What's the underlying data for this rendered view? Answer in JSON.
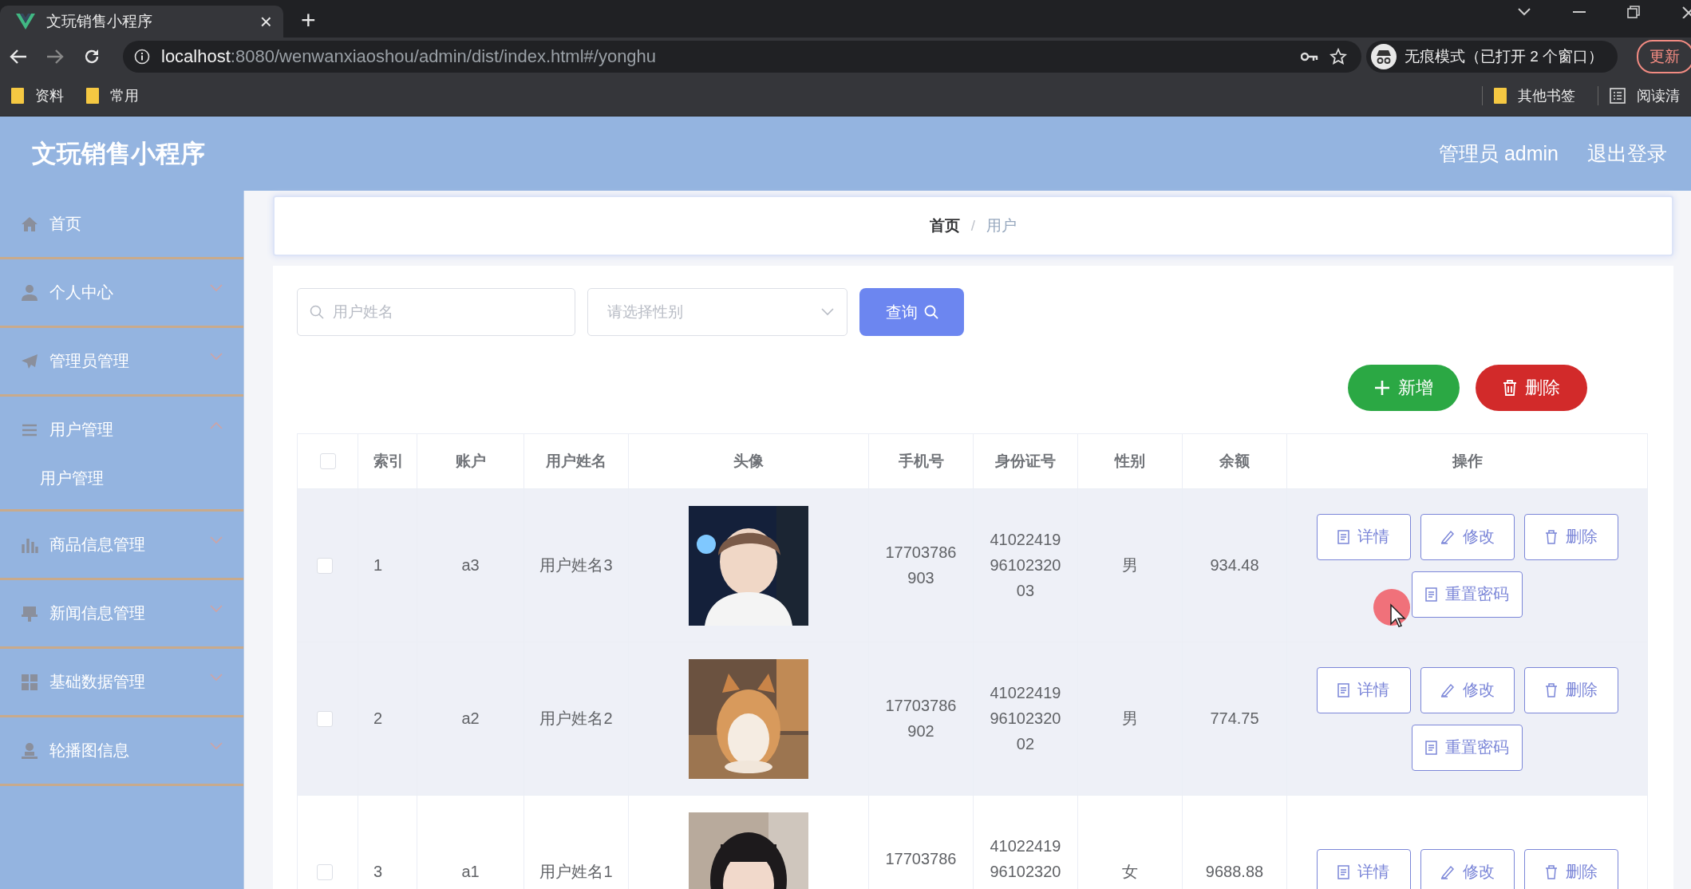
{
  "browser": {
    "tab_title": "文玩销售小程序",
    "tab_close": "×",
    "new_tab": "+",
    "url_host": "localhost",
    "url_path": ":8080/wenwanxiaoshou/admin/dist/index.html#/yonghu",
    "incognito": "无痕模式（已打开 2 个窗口）",
    "update": "更新",
    "bookmarks": [
      {
        "label": "资料",
        "kind": "folder"
      },
      {
        "label": "常用",
        "kind": "folder"
      }
    ],
    "bookmarks_right": [
      {
        "label": "其他书签",
        "kind": "folder"
      },
      {
        "label": "阅读清",
        "kind": "reader"
      }
    ]
  },
  "header": {
    "title": "文玩销售小程序",
    "user": "管理员 admin",
    "logout": "退出登录"
  },
  "sidebar": {
    "items": [
      {
        "label": "首页"
      },
      {
        "label": "个人中心",
        "expanded": false
      },
      {
        "label": "管理员管理",
        "expanded": false
      },
      {
        "label": "用户管理",
        "expanded": true,
        "children": [
          {
            "label": "用户管理"
          }
        ]
      },
      {
        "label": "商品信息管理",
        "expanded": false
      },
      {
        "label": "新闻信息管理",
        "expanded": false
      },
      {
        "label": "基础数据管理",
        "expanded": false
      },
      {
        "label": "轮播图信息",
        "expanded": false
      }
    ]
  },
  "breadcrumb": [
    {
      "label": "首页",
      "current": false
    },
    {
      "label": "用户",
      "current": true
    }
  ],
  "breadcrumb_separator": "/",
  "search": {
    "name_placeholder": "用户姓名",
    "gender_placeholder": "请选择性别",
    "button": "查询"
  },
  "toolbar": {
    "add": "新增",
    "delete": "删除"
  },
  "table": {
    "columns": [
      "索引",
      "账户",
      "用户姓名",
      "头像",
      "手机号",
      "身份证号",
      "性别",
      "余额",
      "操作"
    ],
    "header_checked": false,
    "rows": [
      {
        "checked": false,
        "highlighted": true,
        "index": "1",
        "account": "a3",
        "name": "用户姓名3",
        "avatar": {
          "kind": "picture"
        },
        "phone": "17703786903",
        "id_number": "410224199610232003",
        "gender": "男",
        "balance": "934.48",
        "actions": [
          {
            "label": "详情",
            "kind": "detail"
          },
          {
            "label": "修改",
            "kind": "edit"
          },
          {
            "label": "删除",
            "kind": "delete"
          },
          {
            "label": "重置密码",
            "kind": "detail"
          }
        ]
      },
      {
        "checked": false,
        "highlighted": true,
        "index": "2",
        "account": "a2",
        "name": "用户姓名2",
        "avatar": {
          "kind": "picture"
        },
        "phone": "17703786902",
        "id_number": "410224199610232002",
        "gender": "男",
        "balance": "774.75",
        "actions": [
          {
            "label": "详情",
            "kind": "detail"
          },
          {
            "label": "修改",
            "kind": "edit"
          },
          {
            "label": "删除",
            "kind": "delete"
          },
          {
            "label": "重置密码",
            "kind": "detail"
          }
        ]
      },
      {
        "checked": false,
        "highlighted": false,
        "index": "3",
        "account": "a1",
        "name": "用户姓名1",
        "avatar": {
          "kind": "picture"
        },
        "phone": "17703786",
        "id_number": "4102241996102320",
        "gender": "女",
        "balance": "9688.88",
        "actions": [
          {
            "label": "详情",
            "kind": "detail"
          },
          {
            "label": "修改",
            "kind": "edit"
          },
          {
            "label": "删除",
            "kind": "delete"
          }
        ]
      }
    ]
  }
}
